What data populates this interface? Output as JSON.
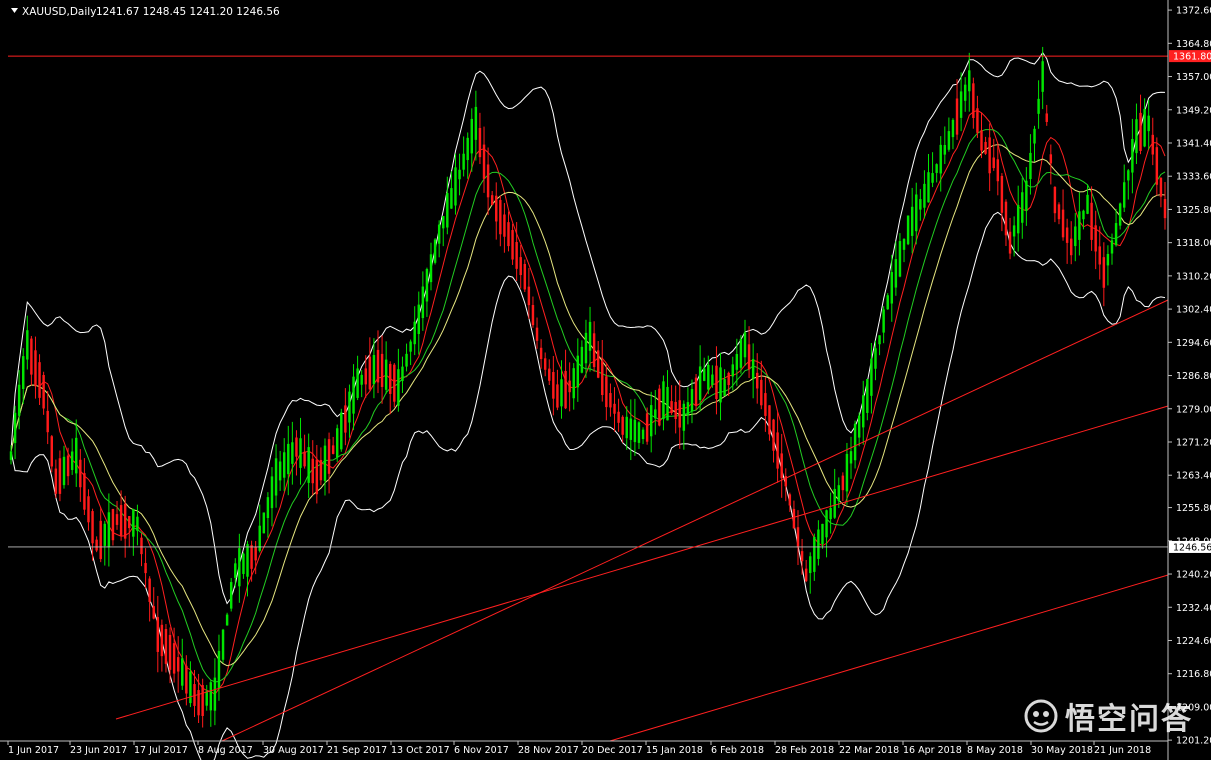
{
  "header": {
    "symbol": "XAUUSD,Daily",
    "ohlc": "1241.67 1248.45 1241.20 1246.56"
  },
  "watermark": {
    "text": "悟空问答"
  },
  "colors": {
    "background": "#000000",
    "frame": "#c0c0c0",
    "bull_candle": "#00e600",
    "bear_candle": "#ff1a1a",
    "bollinger": "#ffffff",
    "ma_fast": "#ff2020",
    "ma_mid": "#22cc22",
    "ma_slow": "#e6e680",
    "trendline": "#ff2020",
    "resistance_line": "#ff2020",
    "price_line": "#c0c0c0"
  },
  "chart_data": {
    "type": "candlestick",
    "instrument": "XAUUSD",
    "timeframe": "Daily",
    "ylim": [
      1201.0,
      1374.5
    ],
    "y_ticks": [
      "1372.60",
      "1364.80",
      "1357.00",
      "1349.20",
      "1341.40",
      "1333.60",
      "1325.80",
      "1318.00",
      "1310.20",
      "1302.40",
      "1294.60",
      "1286.80",
      "1279.00",
      "1271.20",
      "1263.40",
      "1255.80",
      "1248.00",
      "1240.20",
      "1232.40",
      "1224.60",
      "1216.80",
      "1209.00",
      "1201.20"
    ],
    "x_ticks": [
      "1 Jun 2017",
      "23 Jun 2017",
      "17 Jul 2017",
      "8 Aug 2017",
      "30 Aug 2017",
      "21 Sep 2017",
      "13 Oct 2017",
      "6 Nov 2017",
      "28 Nov 2017",
      "20 Dec 2017",
      "15 Jan 2018",
      "6 Feb 2018",
      "28 Feb 2018",
      "22 Mar 2018",
      "16 Apr 2018",
      "8 May 2018",
      "30 May 2018",
      "21 Jun 2018"
    ],
    "bar_count": 284,
    "price_anchors": [
      {
        "bar": 0,
        "close": 1268
      },
      {
        "bar": 4,
        "close": 1294
      },
      {
        "bar": 8,
        "close": 1283
      },
      {
        "bar": 11,
        "close": 1262
      },
      {
        "bar": 16,
        "close": 1268
      },
      {
        "bar": 21,
        "close": 1247
      },
      {
        "bar": 26,
        "close": 1253
      },
      {
        "bar": 31,
        "close": 1252
      },
      {
        "bar": 36,
        "close": 1226
      },
      {
        "bar": 41,
        "close": 1219
      },
      {
        "bar": 46,
        "close": 1210
      },
      {
        "bar": 50,
        "close": 1212
      },
      {
        "bar": 55,
        "close": 1241
      },
      {
        "bar": 60,
        "close": 1245
      },
      {
        "bar": 65,
        "close": 1263
      },
      {
        "bar": 70,
        "close": 1270
      },
      {
        "bar": 75,
        "close": 1263
      },
      {
        "bar": 80,
        "close": 1271
      },
      {
        "bar": 85,
        "close": 1285
      },
      {
        "bar": 90,
        "close": 1289
      },
      {
        "bar": 95,
        "close": 1284
      },
      {
        "bar": 100,
        "close": 1300
      },
      {
        "bar": 105,
        "close": 1320
      },
      {
        "bar": 110,
        "close": 1334
      },
      {
        "bar": 114,
        "close": 1346
      },
      {
        "bar": 118,
        "close": 1328
      },
      {
        "bar": 122,
        "close": 1320
      },
      {
        "bar": 126,
        "close": 1310
      },
      {
        "bar": 130,
        "close": 1292
      },
      {
        "bar": 134,
        "close": 1282
      },
      {
        "bar": 138,
        "close": 1285
      },
      {
        "bar": 142,
        "close": 1296
      },
      {
        "bar": 146,
        "close": 1283
      },
      {
        "bar": 150,
        "close": 1275
      },
      {
        "bar": 155,
        "close": 1273
      },
      {
        "bar": 160,
        "close": 1281
      },
      {
        "bar": 165,
        "close": 1277
      },
      {
        "bar": 170,
        "close": 1287
      },
      {
        "bar": 175,
        "close": 1284
      },
      {
        "bar": 180,
        "close": 1294
      },
      {
        "bar": 185,
        "close": 1280
      },
      {
        "bar": 190,
        "close": 1262
      },
      {
        "bar": 195,
        "close": 1240
      },
      {
        "bar": 200,
        "close": 1252
      },
      {
        "bar": 205,
        "close": 1264
      },
      {
        "bar": 210,
        "close": 1282
      },
      {
        "bar": 215,
        "close": 1304
      },
      {
        "bar": 220,
        "close": 1321
      },
      {
        "bar": 225,
        "close": 1331
      },
      {
        "bar": 230,
        "close": 1342
      },
      {
        "bar": 235,
        "close": 1356
      },
      {
        "bar": 238,
        "close": 1342
      },
      {
        "bar": 242,
        "close": 1335
      },
      {
        "bar": 245,
        "close": 1318
      },
      {
        "bar": 249,
        "close": 1329
      },
      {
        "bar": 253,
        "close": 1357
      },
      {
        "bar": 256,
        "close": 1328
      },
      {
        "bar": 260,
        "close": 1317
      },
      {
        "bar": 264,
        "close": 1327
      },
      {
        "bar": 268,
        "close": 1311
      },
      {
        "bar": 271,
        "close": 1320
      },
      {
        "bar": 276,
        "close": 1343
      },
      {
        "bar": 279,
        "close": 1346
      },
      {
        "bar": 283,
        "close": 1326
      },
      {
        "bar": 287,
        "close": 1318
      },
      {
        "bar": 291,
        "close": 1315
      }
    ],
    "resistance_level": 1361.8,
    "resistance_label": "1361.80",
    "current_price": 1246.56,
    "current_price_label": "1246.56",
    "trendlines": [
      {
        "from": {
          "x": "17 Jul 2017",
          "y": 1205.5
        },
        "to": {
          "x": "21 Jun 2018 (right edge)",
          "y": 1280.0
        }
      },
      {
        "from": {
          "x": "8 Aug 2017",
          "y": 1201.0
        },
        "to": {
          "x": "21 Jun 2018 (right edge)",
          "y": 1303.0
        }
      },
      {
        "from": {
          "x": "20 Dec 2017",
          "y": 1201.0
        },
        "to": {
          "x": "21 Jun 2018 (right edge)",
          "y": 1240.0
        }
      }
    ],
    "indicators": [
      "Bollinger Bands",
      "Moving Average (fast)",
      "Moving Average (mid)",
      "Moving Average (slow)"
    ]
  }
}
